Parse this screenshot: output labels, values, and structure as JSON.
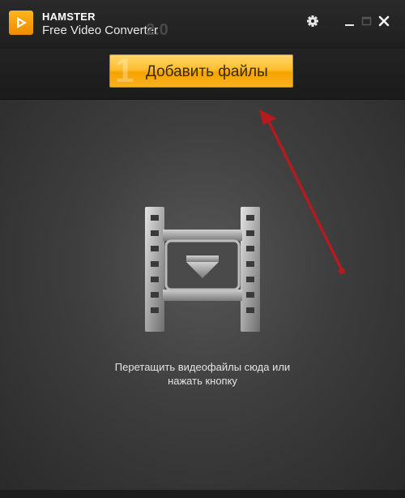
{
  "app": {
    "name": "HAMSTER",
    "subtitle": "Free Video Converter",
    "version": "2.0"
  },
  "window_controls": [
    "gear-icon",
    "minimize-icon",
    "maximize-icon",
    "close-icon"
  ],
  "toolbar": {
    "step_number": "1",
    "add_button_label": "Добавить файлы"
  },
  "dropzone": {
    "line1": "Перетащить видеофайлы сюда или",
    "line2": "нажать кнопку"
  },
  "colors": {
    "accent": "#f7a81a",
    "arrow": "#c0161c",
    "background": "#2b2b2b"
  }
}
